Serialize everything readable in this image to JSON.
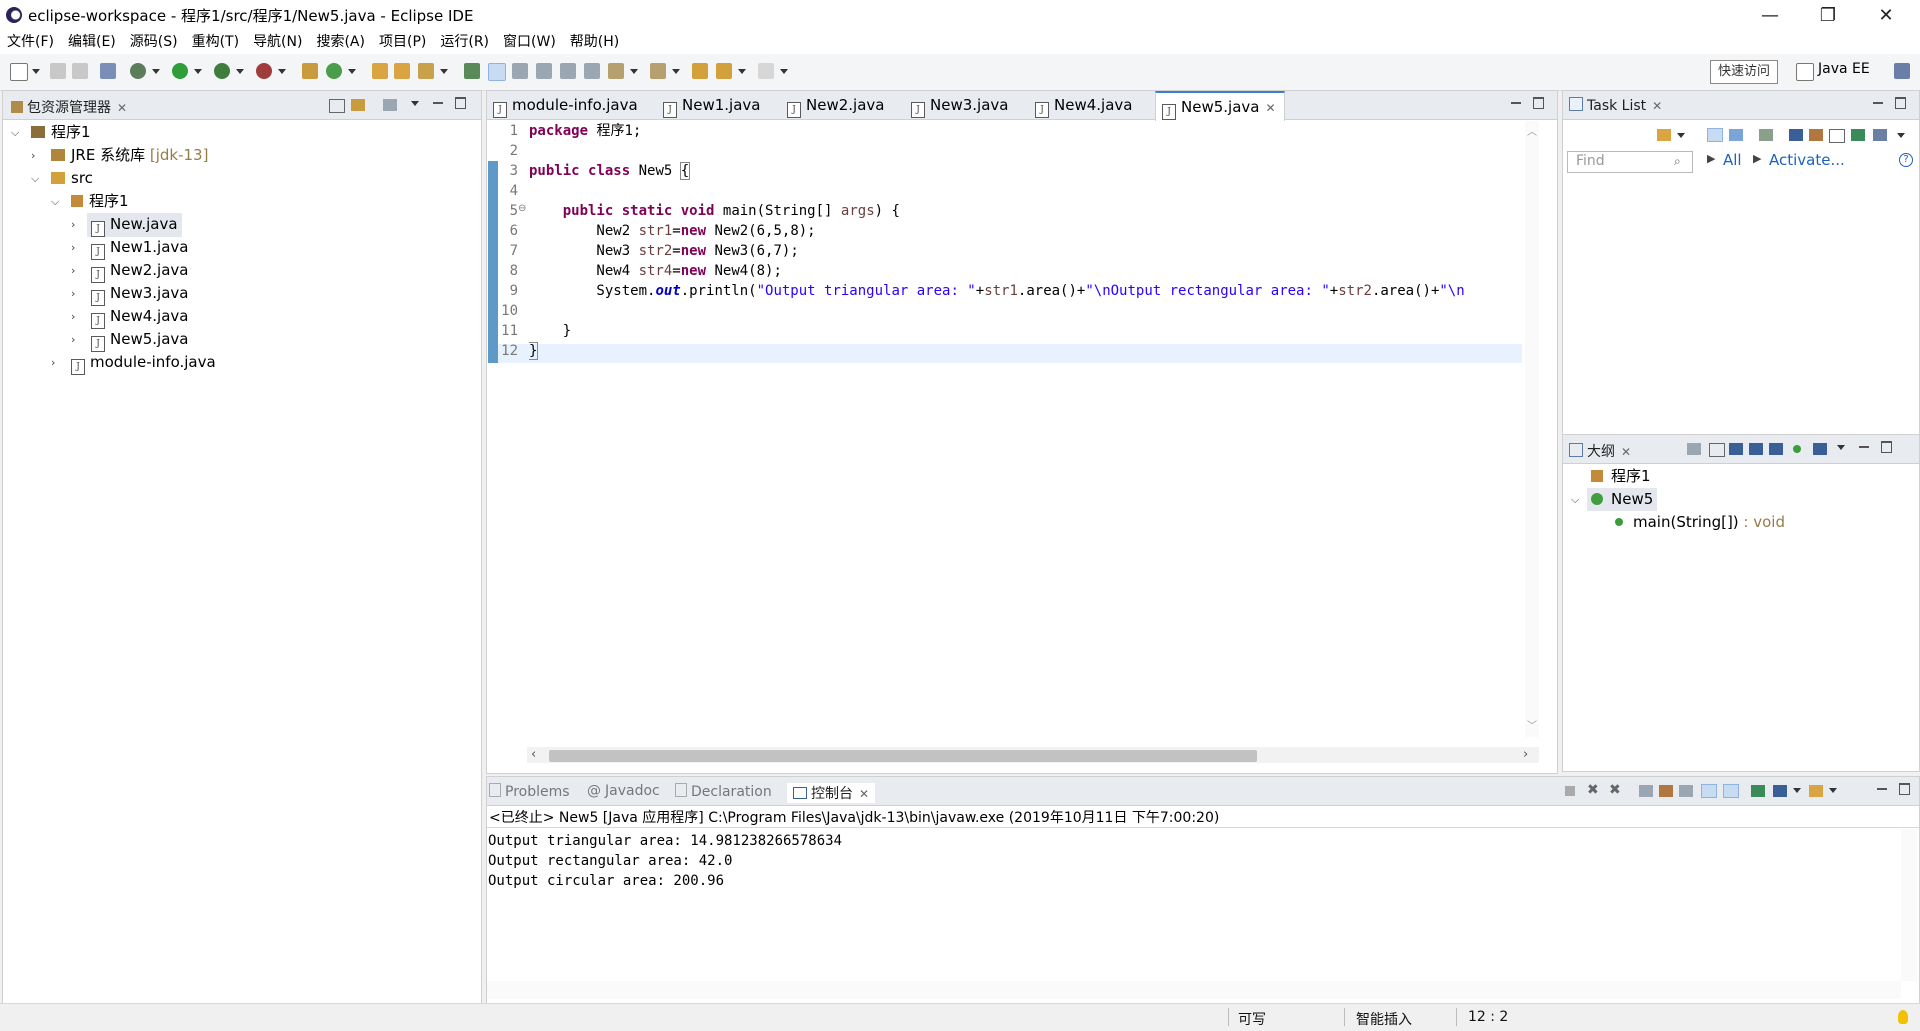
{
  "window": {
    "title": "eclipse-workspace - 程序1/src/程序1/New5.java - Eclipse IDE",
    "minimize": "—",
    "restore": "❐",
    "close": "✕"
  },
  "menu": [
    "文件(F)",
    "编辑(E)",
    "源码(S)",
    "重构(T)",
    "导航(N)",
    "搜索(A)",
    "项目(P)",
    "运行(R)",
    "窗口(W)",
    "帮助(H)"
  ],
  "toolbar": {
    "quick_access": "快速访问",
    "perspective": "Java EE"
  },
  "package_explorer": {
    "title": "包资源管理器",
    "tree": [
      {
        "label": "程序1",
        "chevron": "⌵",
        "icon": "project-icon"
      },
      {
        "label": "JRE 系统库",
        "suffix": "[jdk-13]",
        "chevron": "›",
        "icon": "library-icon"
      },
      {
        "label": "src",
        "chevron": "⌵",
        "icon": "source-folder-icon"
      },
      {
        "label": "程序1",
        "chevron": "⌵",
        "icon": "package-icon"
      },
      {
        "label": "New.java",
        "chevron": "›",
        "icon": "java-file-icon",
        "selected": true
      },
      {
        "label": "New1.java",
        "chevron": "›",
        "icon": "java-file-icon"
      },
      {
        "label": "New2.java",
        "chevron": "›",
        "icon": "java-file-icon"
      },
      {
        "label": "New3.java",
        "chevron": "›",
        "icon": "java-file-icon"
      },
      {
        "label": "New4.java",
        "chevron": "›",
        "icon": "java-file-icon"
      },
      {
        "label": "New5.java",
        "chevron": "›",
        "icon": "java-file-icon"
      },
      {
        "label": "module-info.java",
        "chevron": "›",
        "icon": "java-file-icon"
      }
    ]
  },
  "editor": {
    "tabs": [
      {
        "label": "module-info.java"
      },
      {
        "label": "New1.java"
      },
      {
        "label": "New2.java"
      },
      {
        "label": "New3.java"
      },
      {
        "label": "New4.java"
      },
      {
        "label": "New5.java",
        "active": true
      }
    ],
    "line_numbers": [
      "1",
      "2",
      "3",
      "4",
      "5",
      "6",
      "7",
      "8",
      "9",
      "10",
      "11",
      "12"
    ],
    "fold_marker": "⊖",
    "code": {
      "l1_kw": "package",
      "l1_rest": " 程序1;",
      "l3_kw1": "public",
      "l3_kw2": "class",
      "l3_rest": " New5 ",
      "l3_brace": "{",
      "l5_indent": "    ",
      "l5_kw1": "public",
      "l5_kw2": "static",
      "l5_kw3": "void",
      "l5_a": " main(String[] ",
      "l5_param": "args",
      "l5_b": ") {",
      "l6_a": "        New2 ",
      "l6_var": "str1",
      "l6_eq": "=",
      "l6_kw": "new",
      "l6_b": " New2(6,5,8);",
      "l7_a": "        New3 ",
      "l7_var": "str2",
      "l7_eq": "=",
      "l7_kw": "new",
      "l7_b": " New3(6,7);",
      "l8_a": "        New4 ",
      "l8_var": "str4",
      "l8_eq": "=",
      "l8_kw": "new",
      "l8_b": " New4(8);",
      "l9_a": "        System.",
      "l9_out": "out",
      "l9_b": ".println(",
      "l9_s1": "\"Output triangular area: \"",
      "l9_c": "+",
      "l9_v1": "str1",
      "l9_d": ".area()+",
      "l9_s2": "\"\\nOutput rectangular area: \"",
      "l9_e": "+",
      "l9_v2": "str2",
      "l9_f": ".area()+",
      "l9_s3": "\"\\n",
      "l11": "    }",
      "l12": "}"
    }
  },
  "task_list": {
    "title": "Task List",
    "find_placeholder": "Find",
    "all_label": "All",
    "activate_label": "Activate...",
    "help": "?"
  },
  "outline": {
    "title": "大纲",
    "items": [
      {
        "label": "程序1"
      },
      {
        "label": "New5"
      },
      {
        "label": "main(String[])",
        "type": " : void"
      }
    ]
  },
  "bottom_panel": {
    "tabs": [
      {
        "label": "Problems"
      },
      {
        "label": "Javadoc"
      },
      {
        "label": "Declaration"
      },
      {
        "label": "控制台",
        "active": true
      }
    ],
    "console_header": "<已终止> New5 [Java 应用程序] C:\\Program Files\\Java\\jdk-13\\bin\\javaw.exe (2019年10月11日 下午7:00:20)",
    "console_lines": [
      "Output triangular area: 14.981238266578634",
      "Output rectangular area: 42.0",
      "Output circular area: 200.96"
    ]
  },
  "status": {
    "writable": "可写",
    "insert_mode": "智能插入",
    "position": "12 : 2"
  },
  "colors": {
    "keyword": "#7f0055",
    "string": "#2a00ff",
    "static_field": "#0000c0",
    "variable": "#6a3e3e",
    "link": "#2060c0",
    "accent": "#3c7fd0"
  }
}
